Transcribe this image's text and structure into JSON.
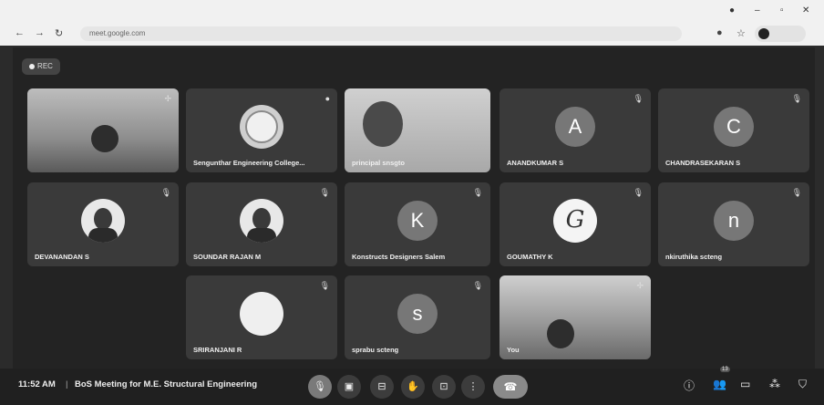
{
  "browser": {
    "tab_title": "",
    "url": "meet.google.com",
    "profile_label": ""
  },
  "recording": {
    "label": "REC"
  },
  "tiles": [
    {
      "name": "",
      "type": "video"
    },
    {
      "name": "Sengunthar Engineering College...",
      "type": "logo"
    },
    {
      "name": "principal snsgto",
      "type": "video"
    },
    {
      "name": "ANANDKUMAR S",
      "type": "avatar",
      "initial": "A"
    },
    {
      "name": "CHANDRASEKARAN S",
      "type": "avatar",
      "initial": "C"
    },
    {
      "name": "DEVANANDAN S",
      "type": "photo"
    },
    {
      "name": "SOUNDAR RAJAN M",
      "type": "photo"
    },
    {
      "name": "Konstructs Designers Salem",
      "type": "avatar",
      "initial": "K"
    },
    {
      "name": "GOUMATHY K",
      "type": "signature",
      "initial": "G"
    },
    {
      "name": "nkiruthika scteng",
      "type": "avatar",
      "initial": "n"
    },
    {
      "name": "SRIRANJANI R",
      "type": "photo"
    },
    {
      "name": "sprabu scteng",
      "type": "avatar",
      "initial": "s"
    },
    {
      "name": "You",
      "type": "video"
    }
  ],
  "bottom_bar": {
    "time": "11:52 AM",
    "divider": "|",
    "meeting_title": "BoS Meeting for M.E. Structural Engineering",
    "people_count": "13"
  },
  "icons": {
    "mic_off": "mic-off-icon",
    "camera": "camera-icon",
    "captions": "captions-icon",
    "hand": "raise-hand-icon",
    "present": "present-icon",
    "more": "more-options-icon",
    "end_call": "end-call-icon",
    "info": "info-icon",
    "people": "people-icon",
    "chat": "chat-icon",
    "activities": "activities-icon",
    "host_controls": "host-controls-icon"
  }
}
